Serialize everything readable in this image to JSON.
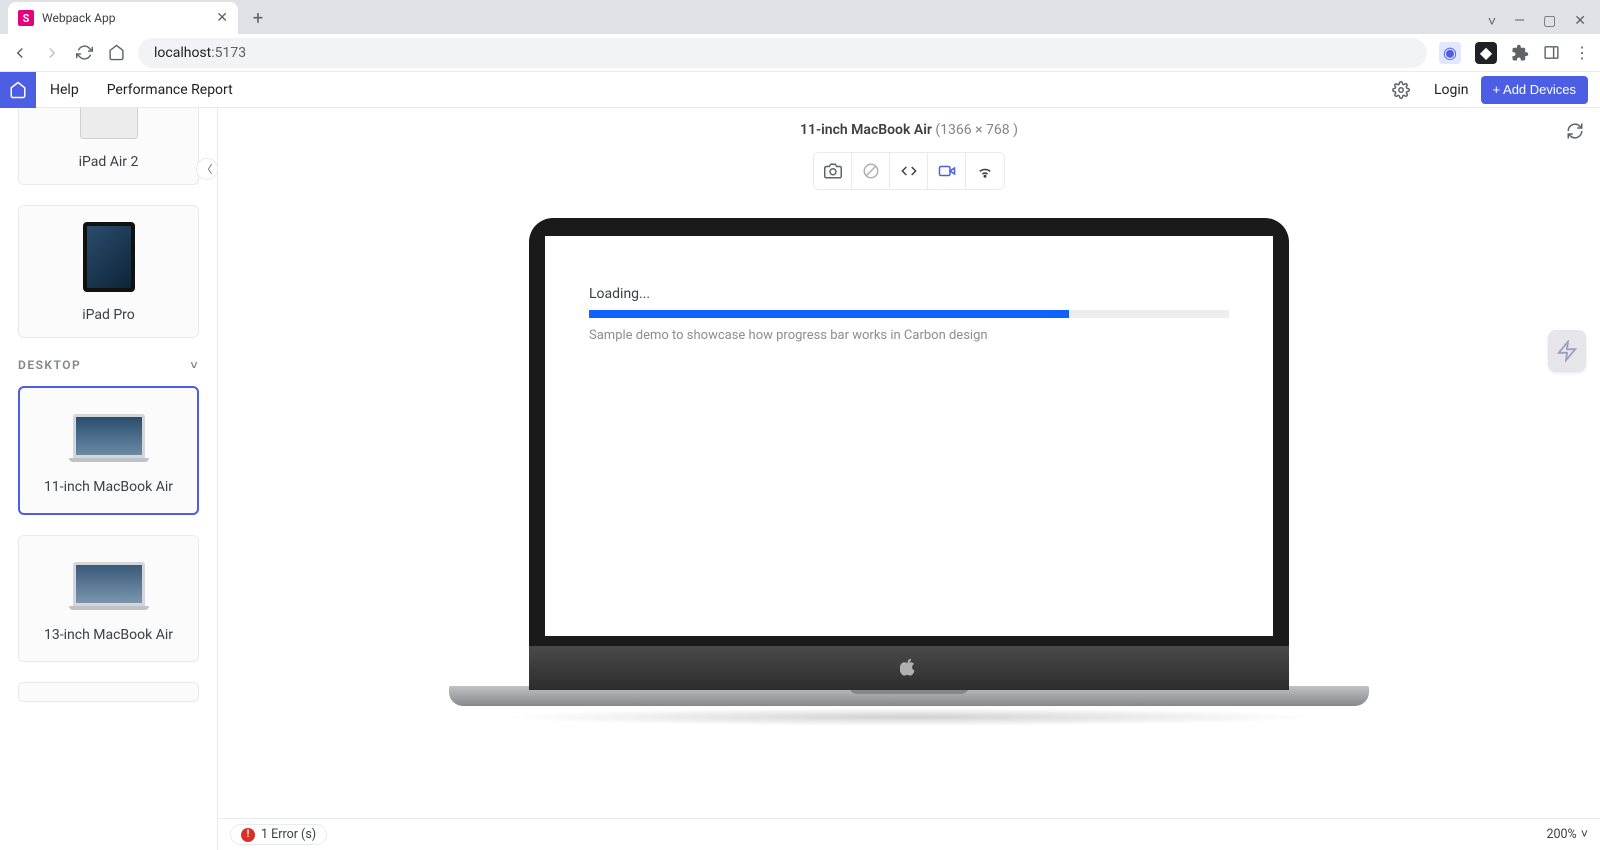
{
  "browser": {
    "tab_title": "Webpack App",
    "favicon_letter": "S",
    "url_host": "localhost",
    "url_port": ":5173"
  },
  "appbar": {
    "help": "Help",
    "perf_report": "Performance Report",
    "login": "Login",
    "add_devices": "+ Add Devices"
  },
  "sidebar": {
    "section_desktop": "DESKTOP",
    "devices": {
      "ipad_air2": "iPad Air 2",
      "ipad_pro": "iPad Pro",
      "mba11": "11-inch MacBook Air",
      "mba13": "13-inch MacBook Air"
    }
  },
  "preview": {
    "title": "11-inch MacBook Air",
    "dimensions": "(1366 × 768 )",
    "content": {
      "loading_label": "Loading...",
      "progress_percent": 75,
      "helper_text": "Sample demo to showcase how progress bar works in Carbon design"
    }
  },
  "status": {
    "error_label": "1 Error (s)",
    "zoom": "200%"
  }
}
